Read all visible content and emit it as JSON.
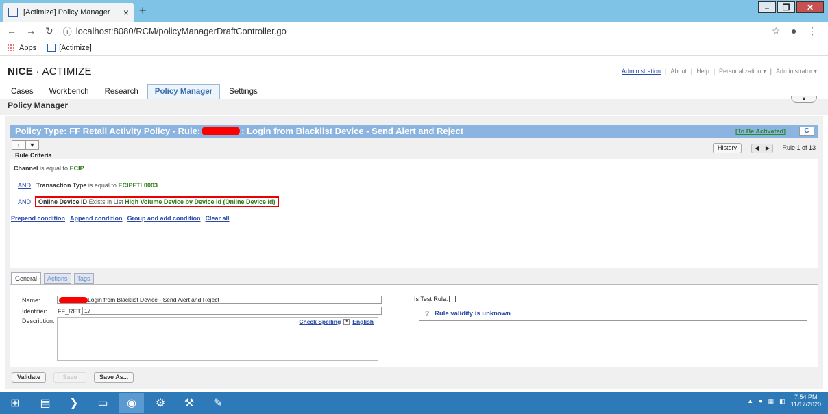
{
  "browser": {
    "tab_title": "[Actimize] Policy Manager",
    "tab_close": "×",
    "new_tab": "+",
    "url": "localhost:8080/RCM/policyManagerDraftController.go",
    "bookmarks": [
      {
        "label": "Apps"
      },
      {
        "label": "[Actimize]"
      }
    ]
  },
  "header": {
    "logo_bold": "NICE",
    "logo_sep": " · ",
    "logo_thin": "ACTIMIZE",
    "links": [
      "Administration",
      "About",
      "Help",
      "Personalization ▾",
      "Administrator ▾"
    ]
  },
  "main_tabs": [
    "Cases",
    "Workbench",
    "Research",
    "Policy Manager",
    "Settings"
  ],
  "page_title": "Policy Manager",
  "rule": {
    "title_prefix": "Policy Type: FF Retail Activity Policy - Rule: ",
    "title_suffix": ": Login from Blacklist Device - Send Alert and Reject",
    "status": "[To Be Activated]",
    "refresh_glyph": "C",
    "criteria_header": "Rule Criteria",
    "history_label": "History",
    "rule_count": "Rule 1 of 13"
  },
  "criteria": [
    {
      "and": "",
      "field": "Channel",
      "op": "is equal to",
      "value": "ECIP"
    },
    {
      "and": "AND",
      "field": "Transaction Type",
      "op": "is equal to",
      "value": "ECIPFTL0003"
    },
    {
      "and": "AND",
      "field": "Online Device ID",
      "op": "Exists in List",
      "value": "High Volume Device by Device Id (Online Device Id)"
    }
  ],
  "criteria_links": [
    "Prepend condition",
    "Append condition",
    "Group and add condition",
    "Clear all"
  ],
  "sub_tabs": [
    "General",
    "Actions",
    "Tags"
  ],
  "general": {
    "name_label": "Name:",
    "name_value": "Login from Blacklist Device - Send Alert and Reject",
    "identifier_label": "Identifier:",
    "identifier_prefix": "FF_RET_",
    "identifier_value": "17",
    "description_label": "Description:",
    "check_spelling": "Check Spelling",
    "language": "English",
    "is_test_label": "Is Test Rule:",
    "validity_icon": "?",
    "validity_text": "Rule validity is unknown"
  },
  "buttons": {
    "validate": "Validate",
    "save": "Save",
    "save_as": "Save As..."
  },
  "taskbar": {
    "time": "7:54 PM",
    "date": "11/17/2020"
  }
}
